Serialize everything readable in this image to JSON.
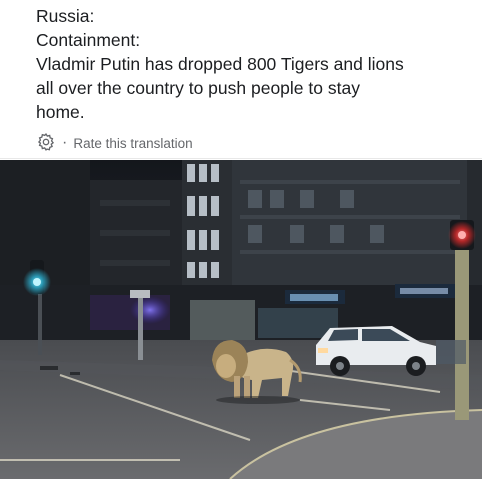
{
  "post": {
    "lines": [
      "Russia:",
      "Containment:",
      "Vladmir Putin has dropped 800 Tigers and lions",
      "all over the country to push people to stay",
      "home."
    ]
  },
  "translation": {
    "icon": "gear-icon",
    "separator": "·",
    "link_label": "Rate this translation"
  },
  "photo": {
    "description_icon": "photo"
  },
  "colors": {
    "text": "#1c1e21",
    "muted": "#65676b"
  }
}
